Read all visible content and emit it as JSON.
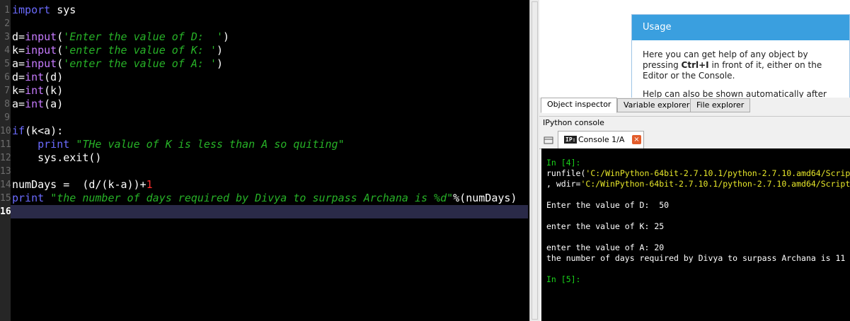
{
  "editor": {
    "line_numbers": [
      "1",
      "2",
      "3",
      "4",
      "5",
      "6",
      "7",
      "8",
      "9",
      "10",
      "11",
      "12",
      "13",
      "14",
      "15",
      "16"
    ],
    "current_line": "16",
    "lines": [
      [
        {
          "t": "import",
          "c": "kw"
        },
        {
          "t": " sys",
          "c": "pl"
        }
      ],
      [],
      [
        {
          "t": "d=",
          "c": "pl"
        },
        {
          "t": "input",
          "c": "fn"
        },
        {
          "t": "(",
          "c": "pl"
        },
        {
          "t": "'Enter the value of D:  '",
          "c": "str"
        },
        {
          "t": ")",
          "c": "pl"
        }
      ],
      [
        {
          "t": "k=",
          "c": "pl"
        },
        {
          "t": "input",
          "c": "fn"
        },
        {
          "t": "(",
          "c": "pl"
        },
        {
          "t": "'enter the value of K: '",
          "c": "str"
        },
        {
          "t": ")",
          "c": "pl"
        }
      ],
      [
        {
          "t": "a=",
          "c": "pl"
        },
        {
          "t": "input",
          "c": "fn"
        },
        {
          "t": "(",
          "c": "pl"
        },
        {
          "t": "'enter the value of A: '",
          "c": "str"
        },
        {
          "t": ")",
          "c": "pl"
        }
      ],
      [
        {
          "t": "d=",
          "c": "pl"
        },
        {
          "t": "int",
          "c": "bi"
        },
        {
          "t": "(d)",
          "c": "pl"
        }
      ],
      [
        {
          "t": "k=",
          "c": "pl"
        },
        {
          "t": "int",
          "c": "bi"
        },
        {
          "t": "(k)",
          "c": "pl"
        }
      ],
      [
        {
          "t": "a=",
          "c": "pl"
        },
        {
          "t": "int",
          "c": "bi"
        },
        {
          "t": "(a)",
          "c": "pl"
        }
      ],
      [],
      [
        {
          "t": "if",
          "c": "kw"
        },
        {
          "t": "(k<a):",
          "c": "pl"
        }
      ],
      [
        {
          "t": "    ",
          "c": "pl"
        },
        {
          "t": "print",
          "c": "kw"
        },
        {
          "t": " ",
          "c": "pl"
        },
        {
          "t": "\"THe value of K is less than A so quiting\"",
          "c": "str"
        }
      ],
      [
        {
          "t": "    sys.exit()",
          "c": "pl"
        }
      ],
      [],
      [
        {
          "t": "numDays =  (d/(k-a))+",
          "c": "pl"
        },
        {
          "t": "1",
          "c": "num"
        }
      ],
      [
        {
          "t": "print",
          "c": "kw"
        },
        {
          "t": " ",
          "c": "pl"
        },
        {
          "t": "\"the number of days required by Divya to surpass Archana is %d\"",
          "c": "str"
        },
        {
          "t": "%(numDays)",
          "c": "pl"
        }
      ],
      []
    ]
  },
  "help": {
    "title": "Usage",
    "para1_before": "Here you can get help of any object by pressing ",
    "para1_bold": "Ctrl+I",
    "para1_after": " in front of it, either on the Editor or the Console.",
    "para2": "Help can also be shown automatically after writing"
  },
  "tabs": [
    "Object inspector",
    "Variable explorer",
    "File explorer"
  ],
  "ipython_title": "IPython console",
  "console_tab": {
    "badge": "IP:",
    "label": "Console 1/A",
    "close": "×"
  },
  "console": {
    "prompt_in4": "In [4]:",
    "runfile_pre": "runfile(",
    "runfile_str": "'C:/WinPython-64bit-2.7.10.1/python-2.7.10.amd64/Scrip",
    "wdir_pre": ", wdir=",
    "wdir_str": "'C:/WinPython-64bit-2.7.10.1/python-2.7.10.amd64/Script",
    "out1": "Enter the value of D:  50",
    "out2": "enter the value of K: 25",
    "out3": "enter the value of A: 20",
    "out4": "the number of days required by Divya to surpass Archana is 11",
    "prompt_in5": "In [5]:"
  },
  "colors": {
    "editor_bg": "#000000",
    "keyword": "#6b6bff",
    "string": "#27b227",
    "number": "#ff2b2b",
    "usage_header": "#3a9fdf"
  }
}
